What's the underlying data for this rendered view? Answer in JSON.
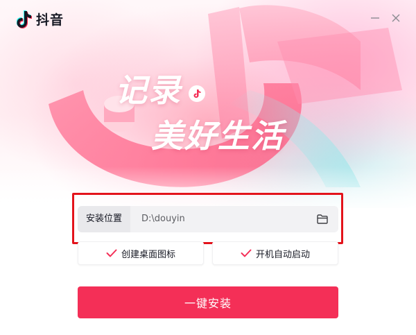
{
  "app": {
    "name": "抖音",
    "logo_icon": "douyin-note-icon"
  },
  "window_controls": {
    "minimize_icon": "minimize-icon",
    "close_icon": "close-icon"
  },
  "hero": {
    "slogan_line1": "记录",
    "slogan_line2": "美好生活",
    "slogan_badge_icon": "music-note-icon"
  },
  "install": {
    "label": "安装位置",
    "path_value": "D:\\douyin",
    "folder_icon": "folder-icon"
  },
  "options": [
    {
      "label": "创建桌面图标",
      "checked": true,
      "icon": "checkmark-icon"
    },
    {
      "label": "开机自动启动",
      "checked": true,
      "icon": "checkmark-icon"
    }
  ],
  "install_button": {
    "label": "一键安装"
  },
  "colors": {
    "accent": "#f42f57",
    "check": "#f42f57",
    "highlight_border": "#e3131b",
    "text_primary": "#161823"
  }
}
